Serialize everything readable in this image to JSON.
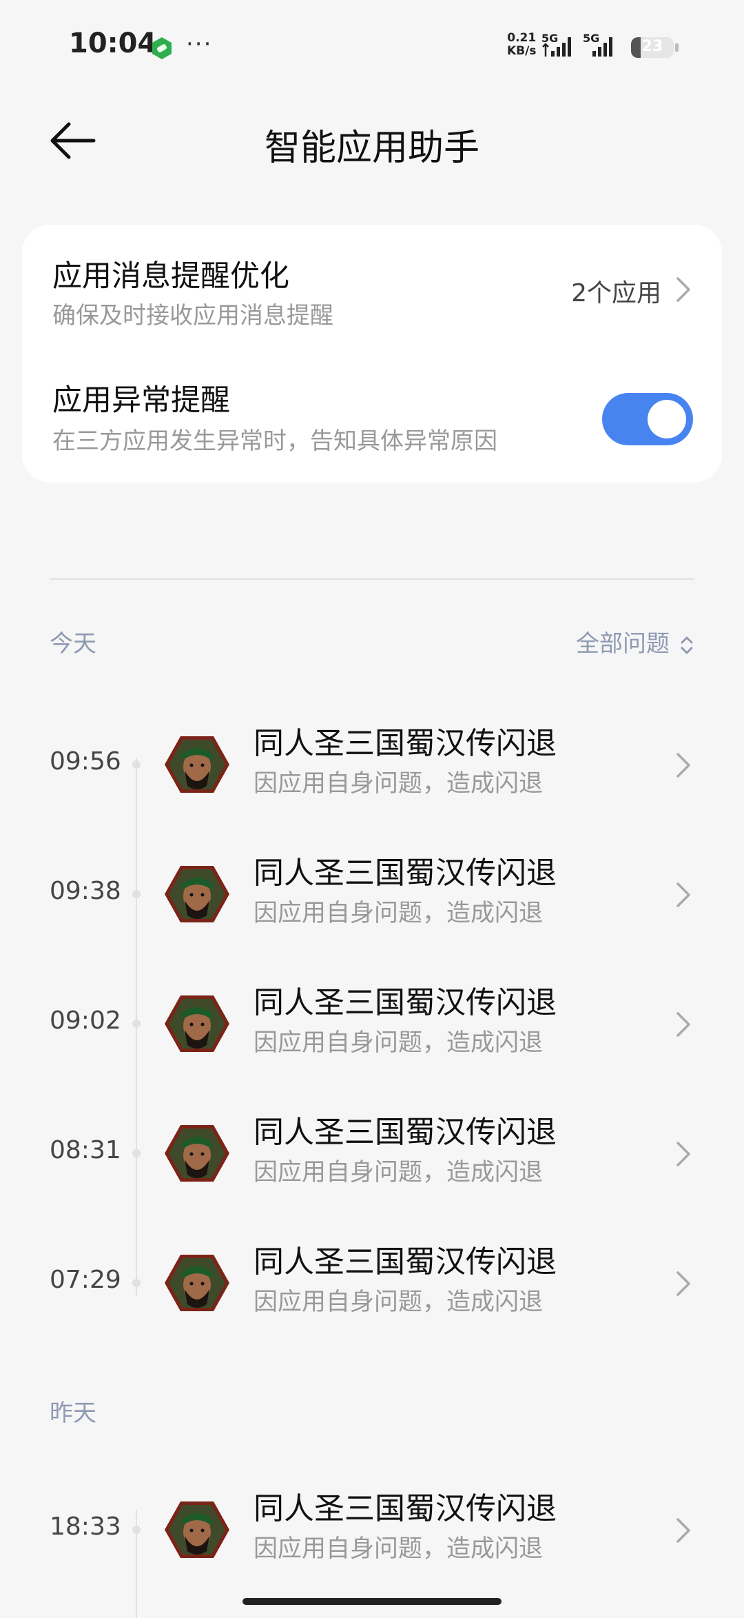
{
  "status_bar": {
    "time": "10:04",
    "dots": "···",
    "net_speed_value": "0.21",
    "net_speed_unit": "KB/s",
    "sim1_label": "5G",
    "sim2_label": "5G",
    "battery": "23"
  },
  "header": {
    "title": "智能应用助手"
  },
  "settings": {
    "notify_opt_title": "应用消息提醒优化",
    "notify_opt_desc": "确保及时接收应用消息提醒",
    "notify_opt_value": "2个应用",
    "abnormal_title": "应用异常提醒",
    "abnormal_desc": "在三方应用发生异常时，告知具体异常原因",
    "abnormal_enabled": true
  },
  "filter": {
    "label": "全部问题"
  },
  "sections": [
    {
      "label": "今天",
      "items": [
        {
          "time": "09:56",
          "app": "同人圣三国蜀汉传闪退",
          "desc": "因应用自身问题，造成闪退"
        },
        {
          "time": "09:38",
          "app": "同人圣三国蜀汉传闪退",
          "desc": "因应用自身问题，造成闪退"
        },
        {
          "time": "09:02",
          "app": "同人圣三国蜀汉传闪退",
          "desc": "因应用自身问题，造成闪退"
        },
        {
          "time": "08:31",
          "app": "同人圣三国蜀汉传闪退",
          "desc": "因应用自身问题，造成闪退"
        },
        {
          "time": "07:29",
          "app": "同人圣三国蜀汉传闪退",
          "desc": "因应用自身问题，造成闪退"
        }
      ]
    },
    {
      "label": "昨天",
      "items": [
        {
          "time": "18:33",
          "app": "同人圣三国蜀汉传闪退",
          "desc": "因应用自身问题，造成闪退"
        }
      ]
    }
  ],
  "colors": {
    "accent": "#4784f0",
    "section_label": "#8f9ab2",
    "background": "#f6f6f6"
  },
  "icons": {
    "back": "arrow-left-icon",
    "chevron": "chevron-right-icon",
    "filter": "chevron-up-down-icon",
    "app": "game-avatar-icon"
  }
}
